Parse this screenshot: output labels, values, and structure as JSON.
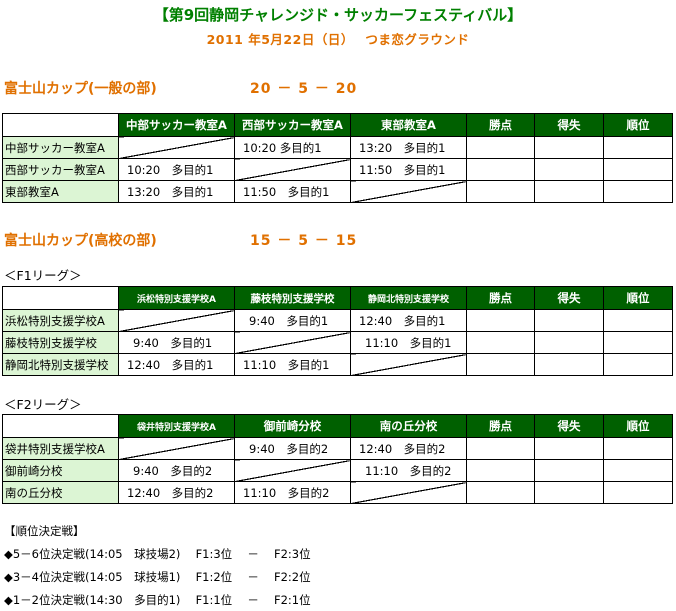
{
  "header": {
    "title": "【第9回静岡チャレンジド・サッカーフェスティバル】",
    "date_venue": "2011 年5月22日（日）　 つま恋グラウンド"
  },
  "sections": [
    {
      "title": "富士山カップ(一般の部)",
      "score": "20 － 5 － 20",
      "columns": [
        "中部サッカー教室A",
        "西部サッカー教室A",
        "東部教室A",
        "勝点",
        "得失",
        "順位"
      ],
      "rows": [
        {
          "name": "中部サッカー教室A",
          "cells": [
            "",
            "10:20 多目的1",
            "13:20　多目的1",
            "",
            "",
            ""
          ]
        },
        {
          "name": "西部サッカー教室A",
          "cells": [
            "10:20　多目的1",
            "",
            "11:50　多目的1",
            "",
            "",
            ""
          ]
        },
        {
          "name": "東部教室A",
          "cells": [
            "13:20　多目的1",
            "11:50　多目的1",
            "",
            "",
            "",
            ""
          ]
        }
      ]
    },
    {
      "title": "富士山カップ(高校の部)",
      "score": "15 － 5 － 15",
      "league": "＜F1リーグ＞",
      "columns": [
        "浜松特別支援学校A",
        "藤枝特別支援学校",
        "静岡北特別支援学校",
        "勝点",
        "得失",
        "順位"
      ],
      "rows": [
        {
          "name": "浜松特別支援学校A",
          "cells": [
            "",
            "9:40　多目的1",
            "12:40　多目的1",
            "",
            "",
            ""
          ]
        },
        {
          "name": "藤枝特別支援学校",
          "cells": [
            "9:40　多目的1",
            "",
            "11:10　多目的1",
            "",
            "",
            ""
          ]
        },
        {
          "name": "静岡北特別支援学校",
          "cells": [
            "12:40　多目的1",
            "11:10　多目的1",
            "",
            "",
            "",
            ""
          ]
        }
      ]
    },
    {
      "league": "＜F2リーグ＞",
      "columns": [
        "袋井特別支援学校A",
        "御前崎分校",
        "南の丘分校",
        "勝点",
        "得失",
        "順位"
      ],
      "rows": [
        {
          "name": "袋井特別支援学校A",
          "cells": [
            "",
            "9:40　多目的2",
            "12:40　多目的2",
            "",
            "",
            ""
          ]
        },
        {
          "name": "御前崎分校",
          "cells": [
            "9:40　多目的2",
            "",
            "11:10　多目的2",
            "",
            "",
            ""
          ]
        },
        {
          "name": "南の丘分校",
          "cells": [
            "12:40　多目的2",
            "11:10　多目的2",
            "",
            "",
            "",
            ""
          ]
        }
      ]
    }
  ],
  "placement": {
    "heading": "【順位決定戦】",
    "items": [
      "◆5－6位決定戦(14:05　球技場2)　 F1:3位　 －　 F2:3位",
      "◆3－4位決定戦(14:05　球技場1)　 F1:2位　 －　 F2:2位",
      "◆1－2位決定戦(14:30　多目的1)　 F1:1位　 －　 F2:1位"
    ]
  }
}
